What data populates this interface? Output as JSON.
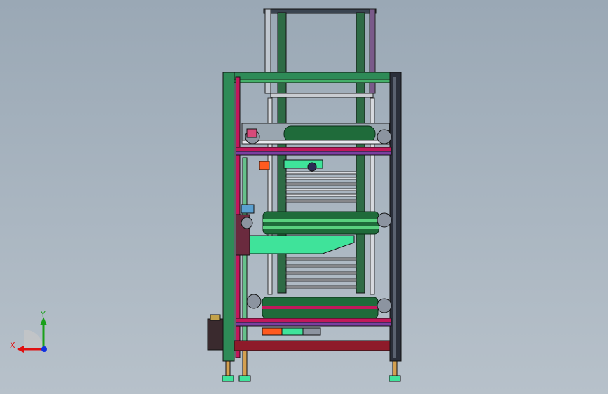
{
  "viewport": {
    "background_top": "#9aa8b5",
    "background_bottom": "#b7c1ca"
  },
  "model": {
    "description_icon": "cad-assembly-model",
    "colors": {
      "frame_green": "#2e8b57",
      "frame_dark": "#2a2f3a",
      "rail_pink": "#c2185b",
      "roller_green": "#1f6b3a",
      "tray_mint": "#3fe39a",
      "motor_orange": "#ff5a1f",
      "base_red": "#8e1b2a",
      "accent_purple": "#7b3fa0"
    }
  },
  "triad": {
    "x_label": "X",
    "y_label": "Y",
    "x_color": "#e01010",
    "y_color": "#1aa01a",
    "z_color": "#1030e0"
  }
}
